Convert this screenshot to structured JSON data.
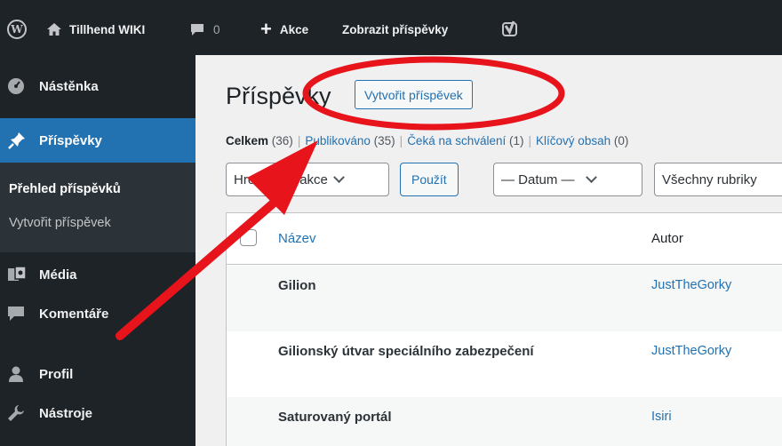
{
  "adminbar": {
    "wp_logo": "W",
    "site_name": "Tillhend WIKI",
    "comments_count": "0",
    "new_label": "Akce",
    "view_posts": "Zobrazit příspěvky"
  },
  "sidebar": {
    "items": [
      {
        "label": "Nástěnka",
        "icon": "dashboard-icon"
      },
      {
        "label": "Příspěvky",
        "icon": "pin-icon"
      },
      {
        "label": "Média",
        "icon": "media-icon"
      },
      {
        "label": "Komentáře",
        "icon": "comment-icon"
      },
      {
        "label": "Profil",
        "icon": "user-icon"
      },
      {
        "label": "Nástroje",
        "icon": "wrench-icon"
      }
    ],
    "submenu": [
      "Přehled příspěvků",
      "Vytvořit příspěvek"
    ]
  },
  "main": {
    "title": "Příspěvky",
    "add_new": "Vytvořit příspěvek",
    "views": [
      {
        "label": "Celkem",
        "count": "(36)"
      },
      {
        "label": "Publikováno",
        "count": "(35)"
      },
      {
        "label": "Čeká na schválení",
        "count": "(1)"
      },
      {
        "label": "Klíčový obsah",
        "count": "(0)"
      }
    ],
    "bulk_action": "Hromadné akce",
    "apply": "Použít",
    "date_filter": "— Datum —",
    "category_filter": "Všechny rubriky",
    "columns": {
      "title": "Název",
      "author": "Autor"
    },
    "rows": [
      {
        "title": "Gilion",
        "author": "JustTheGorky"
      },
      {
        "title": "Gilionský útvar speciálního zabezpečení",
        "author": "JustTheGorky"
      },
      {
        "title": "Saturovaný portál",
        "author": "Isiri"
      }
    ]
  },
  "annotation_color": "#e8141c",
  "accent_color": "#2271b1"
}
